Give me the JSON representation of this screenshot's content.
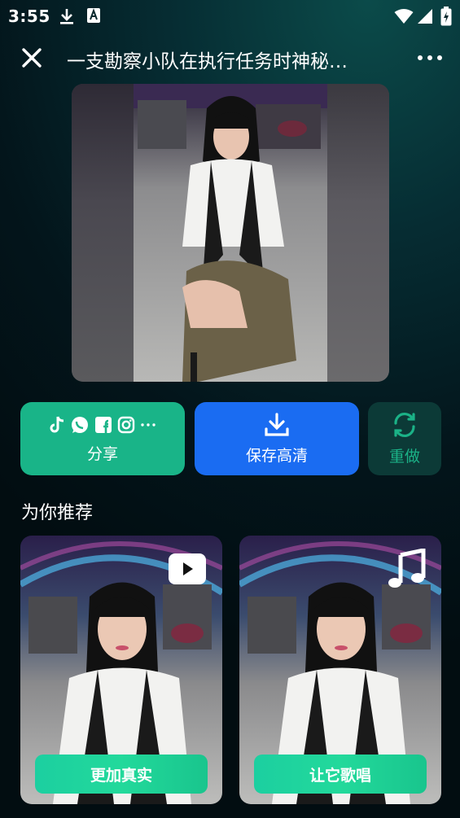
{
  "status_bar": {
    "time": "3:55"
  },
  "header": {
    "title": "一支勘察小队在执行任务时神秘…"
  },
  "actions": {
    "share_label": "分享",
    "save_label": "保存高清",
    "redo_label": "重做"
  },
  "recommend": {
    "title": "为你推荐",
    "cards": [
      {
        "button_label": "更加真实",
        "badge_icon": "play-icon"
      },
      {
        "button_label": "让它歌唱",
        "badge_icon": "music-note-icon"
      }
    ]
  },
  "colors": {
    "share": "#19b488",
    "save": "#1a6cf2",
    "redo_bg": "#0c3a37",
    "redo_text": "#1bb287",
    "card_button": "#1ccfa0"
  }
}
